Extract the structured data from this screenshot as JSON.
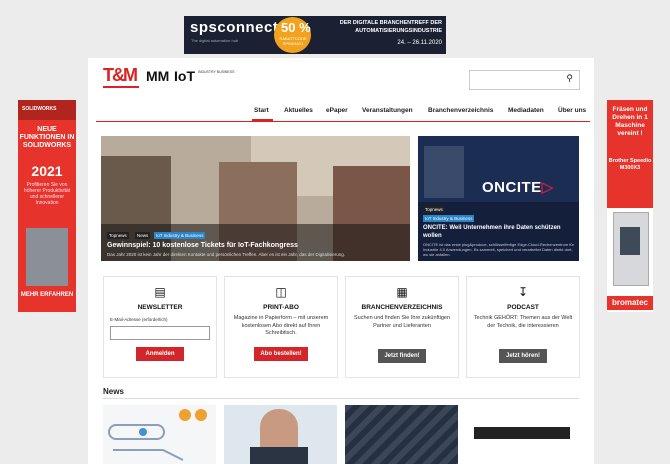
{
  "top_banner": {
    "brand": "spsconnect",
    "brand_sub": "The digital automation hub",
    "badge_percent": "50 %",
    "badge_code": "RABATTCODE SPSXHA21",
    "line1": "DER DIGITALE BRANCHENTREFF DER",
    "line2": "AUTOMATISIERUNGSINDUSTRIE",
    "dates": "24. – 26.11.2020"
  },
  "left_ad": {
    "brand": "SOLIDWORKS",
    "headline": "NEUE FUNKTIONEN IN SOLIDWORKS",
    "year": "2021",
    "text": "Profitieren Sie von höherer Produktivität und schnellerer Innovation",
    "cta": "MEHR ERFAHREN"
  },
  "right_ad": {
    "headline": "Fräsen und Drehen in 1 Maschine vereint !",
    "product": "Brother Speedio M300X3",
    "logo": "bromatec"
  },
  "header": {
    "logo_tm": "T&M",
    "logo_mm": "MM",
    "logo_iot": "IoT",
    "logo_iot_sub": "INDUSTRY BUSINESS",
    "search_icon": "search-icon"
  },
  "nav": {
    "items": [
      "Start",
      "Aktuelles",
      "ePaper",
      "Veranstaltungen",
      "Branchenverzeichnis",
      "Mediadaten",
      "Über uns"
    ]
  },
  "hero": {
    "tags": [
      "Topnews",
      "News",
      "IoT Industry & Business"
    ],
    "headline": "Gewinnspiel: 10 kostenlose Tickets für IoT-Fachkongress",
    "sub": "Das Jahr 2020 ist kein Jahr der direkten Kontakte und persönlichen Treffen. Aber es ist ein Jahr, das der Digitalisierung."
  },
  "side_story": {
    "oncite": "ONCITE",
    "tags": [
      "Topnews",
      "IoT Industry & Business"
    ],
    "headline": "ONCITE: Weil Unternehmen ihre Daten schützen wollen",
    "sub": "ONCITE ist das erste plug&produce, schlüsselfertige Edge-Cloud-Rechenzentrum für Industrie 4.0 Anwendungen. Es sammelt, speichert und verarbeitet Daten direkt dort, wo sie anfallen."
  },
  "cards": [
    {
      "title": "NEWSLETTER",
      "label": "E-Mail-Adresse (erforderlich)",
      "button": "Anmelden"
    },
    {
      "title": "PRINT-ABO",
      "desc": "Magazine in Papierform – mit unserem kostenlosen Abo direkt auf Ihren Schreibtisch.",
      "button": "Abo bestellen!"
    },
    {
      "title": "BRANCHENVERZEICHNIS",
      "desc": "Suchen und finden Sie Ihre zukünftigen Partner und Lieferanten",
      "button": "Jetzt finden!"
    },
    {
      "title": "PODCAST",
      "desc": "Technik GEHÖRT: Themen aus der Welt der Technik, die interessieren",
      "button": "Jetzt hören!"
    }
  ],
  "news": {
    "title": "News"
  }
}
